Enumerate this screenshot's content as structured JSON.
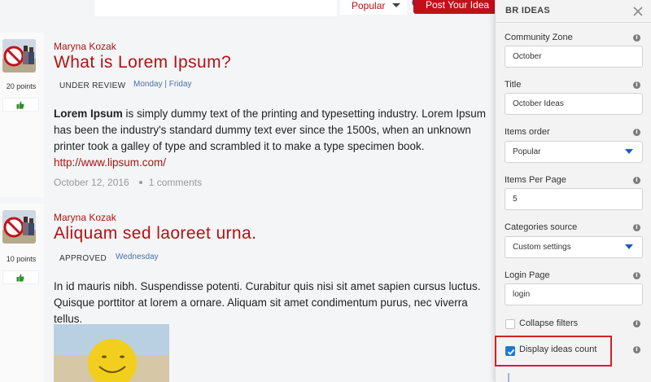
{
  "toolbar": {
    "sort_value": "Popular",
    "post_label": "Post Your Idea"
  },
  "posts": [
    {
      "author": "Maryna Kozak",
      "title": "What is Lorem Ipsum?",
      "status": "UNDER REVIEW",
      "days": "Monday | Friday",
      "points": "20 points",
      "body_bold": "Lorem Ipsum",
      "body_line1_rest": " is simply dummy text of the printing and typesetting industry. Lorem Ipsum",
      "body_line2": "has been the industry's standard dummy text ever since the 1500s, when an unknown",
      "body_line3": "printer took a galley of type and scrambled it to make a type specimen book.",
      "link": "http://www.lipsum.com/",
      "date": "October 12, 2016",
      "comments": "1 comments"
    },
    {
      "author": "Maryna Kozak",
      "title": "Aliquam sed laoreet urna.",
      "status": "APPROVED",
      "days": "Wednesday",
      "points": "10 points",
      "body": "In id mauris nibh. Suspendisse potenti. Curabitur quis nisi sit amet sapien cursus luctus. Quisque porttitor at lorem a ornare. Aliquam sit amet condimentum purus, nec viverra tellus."
    }
  ],
  "panel": {
    "title": "BR IDEAS",
    "fields": [
      {
        "label": "Community Zone",
        "value": "October"
      },
      {
        "label": "Title",
        "value": "October Ideas"
      },
      {
        "label": "Items order",
        "value": "Popular"
      },
      {
        "label": "Items Per Page",
        "value": "5"
      },
      {
        "label": "Categories source",
        "value": "Custom settings"
      },
      {
        "label": "Login Page",
        "value": "login"
      }
    ],
    "collapse_filters": {
      "label": "Collapse filters",
      "checked": false
    },
    "display_ideas_count": {
      "label": "Display ideas count",
      "checked": true
    }
  },
  "colors": {
    "accent": "#b21212",
    "button": "#c1101a",
    "checkbox": "#1f78d1",
    "highlight": "#d02226"
  }
}
